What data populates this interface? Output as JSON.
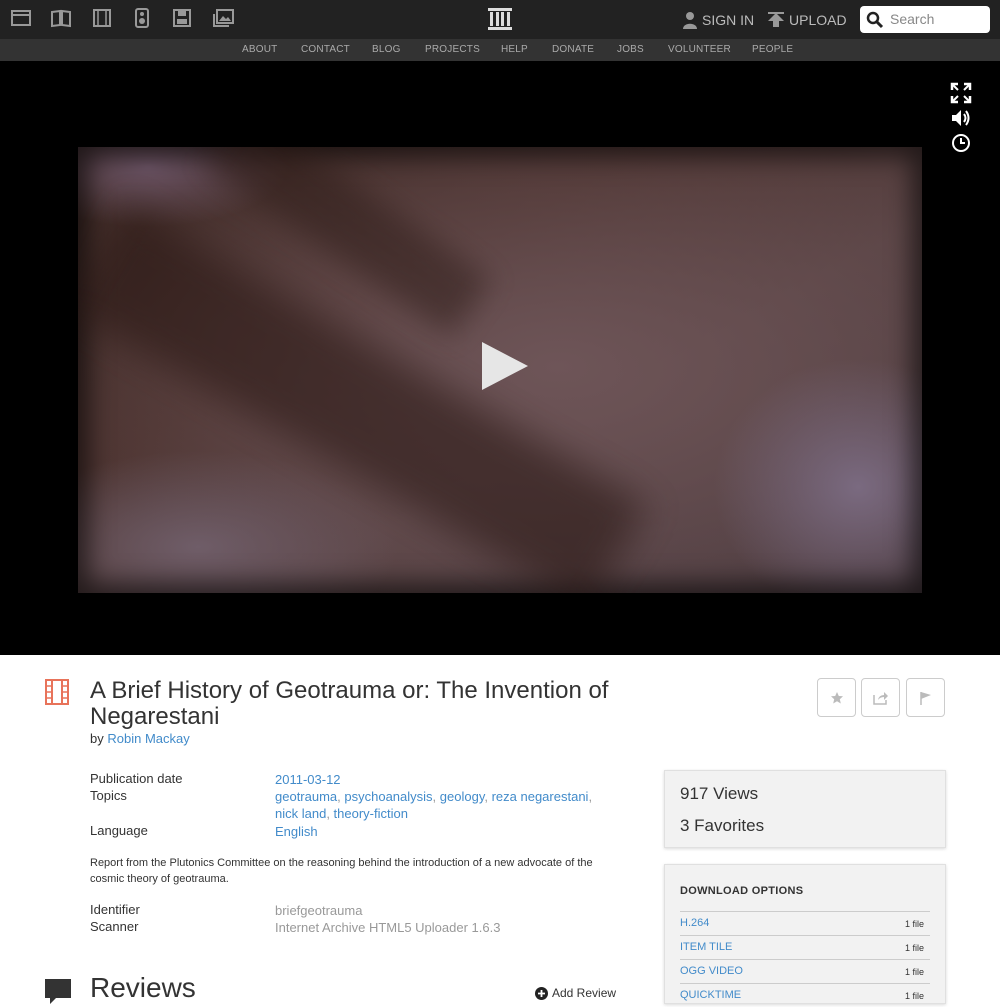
{
  "header": {
    "media_icons": [
      "web-icon",
      "texts-icon",
      "video-icon",
      "audio-icon",
      "software-icon",
      "images-icon"
    ],
    "logo": "archive-logo-icon",
    "sign_in": "SIGN IN",
    "upload": "UPLOAD",
    "search_placeholder": "Search"
  },
  "nav": {
    "links": [
      "ABOUT",
      "CONTACT",
      "BLOG",
      "PROJECTS",
      "HELP",
      "DONATE",
      "JOBS",
      "VOLUNTEER",
      "PEOPLE"
    ]
  },
  "player": {
    "controls": [
      "fullscreen-icon",
      "volume-icon",
      "clock-icon"
    ]
  },
  "item": {
    "title": "A Brief History of Geotrauma or: The Invention of Negarestani",
    "by": "by",
    "author": "Robin Mackay",
    "actions": [
      "favorite-icon",
      "share-icon",
      "flag-icon"
    ]
  },
  "metadata": {
    "publication_date_label": "Publication date",
    "publication_date": "2011-03-12",
    "topics_label": "Topics",
    "topics": [
      "geotrauma",
      "psychoanalysis",
      "geology",
      "reza negarestani",
      "nick land",
      "theory-fiction"
    ],
    "language_label": "Language",
    "language": "English",
    "description": "Report from the Plutonics Committee on the reasoning behind the introduction of a new advocate of the cosmic theory of geotrauma.",
    "identifier_label": "Identifier",
    "identifier": "briefgeotrauma",
    "scanner_label": "Scanner",
    "scanner": "Internet Archive HTML5 Uploader 1.6.3"
  },
  "reviews": {
    "title": "Reviews",
    "add_review": "Add Review"
  },
  "stats": {
    "views": "917 Views",
    "favorites": "3 Favorites"
  },
  "downloads": {
    "heading": "DOWNLOAD OPTIONS",
    "items": [
      {
        "name": "H.264",
        "count": "1 file"
      },
      {
        "name": "ITEM TILE",
        "count": "1 file"
      },
      {
        "name": "OGG VIDEO",
        "count": "1 file"
      },
      {
        "name": "QUICKTIME",
        "count": "1 file"
      }
    ]
  },
  "colors": {
    "link": "#428bca",
    "accent_red": "#e8735a",
    "topbar": "#222222",
    "nav": "#333333"
  }
}
